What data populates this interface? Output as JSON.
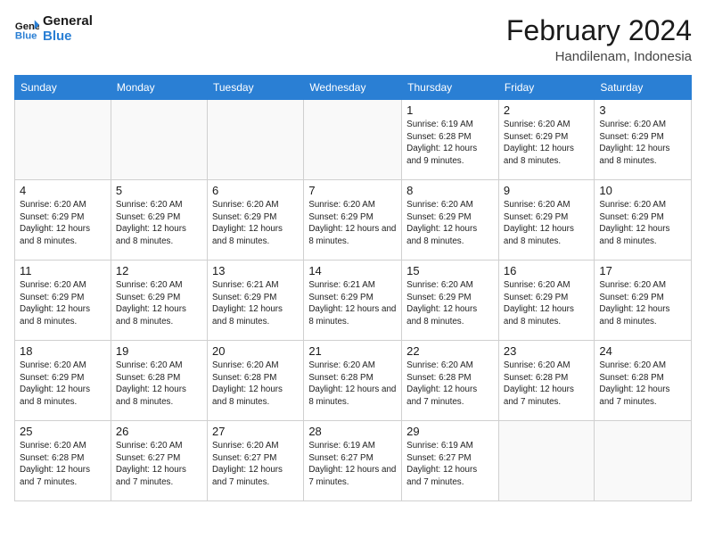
{
  "logo": {
    "line1": "General",
    "line2": "Blue"
  },
  "title": "February 2024",
  "location": "Handilenam, Indonesia",
  "days_of_week": [
    "Sunday",
    "Monday",
    "Tuesday",
    "Wednesday",
    "Thursday",
    "Friday",
    "Saturday"
  ],
  "weeks": [
    [
      {
        "num": "",
        "info": ""
      },
      {
        "num": "",
        "info": ""
      },
      {
        "num": "",
        "info": ""
      },
      {
        "num": "",
        "info": ""
      },
      {
        "num": "1",
        "info": "Sunrise: 6:19 AM\nSunset: 6:28 PM\nDaylight: 12 hours and 9 minutes."
      },
      {
        "num": "2",
        "info": "Sunrise: 6:20 AM\nSunset: 6:29 PM\nDaylight: 12 hours and 8 minutes."
      },
      {
        "num": "3",
        "info": "Sunrise: 6:20 AM\nSunset: 6:29 PM\nDaylight: 12 hours and 8 minutes."
      }
    ],
    [
      {
        "num": "4",
        "info": "Sunrise: 6:20 AM\nSunset: 6:29 PM\nDaylight: 12 hours and 8 minutes."
      },
      {
        "num": "5",
        "info": "Sunrise: 6:20 AM\nSunset: 6:29 PM\nDaylight: 12 hours and 8 minutes."
      },
      {
        "num": "6",
        "info": "Sunrise: 6:20 AM\nSunset: 6:29 PM\nDaylight: 12 hours and 8 minutes."
      },
      {
        "num": "7",
        "info": "Sunrise: 6:20 AM\nSunset: 6:29 PM\nDaylight: 12 hours and 8 minutes."
      },
      {
        "num": "8",
        "info": "Sunrise: 6:20 AM\nSunset: 6:29 PM\nDaylight: 12 hours and 8 minutes."
      },
      {
        "num": "9",
        "info": "Sunrise: 6:20 AM\nSunset: 6:29 PM\nDaylight: 12 hours and 8 minutes."
      },
      {
        "num": "10",
        "info": "Sunrise: 6:20 AM\nSunset: 6:29 PM\nDaylight: 12 hours and 8 minutes."
      }
    ],
    [
      {
        "num": "11",
        "info": "Sunrise: 6:20 AM\nSunset: 6:29 PM\nDaylight: 12 hours and 8 minutes."
      },
      {
        "num": "12",
        "info": "Sunrise: 6:20 AM\nSunset: 6:29 PM\nDaylight: 12 hours and 8 minutes."
      },
      {
        "num": "13",
        "info": "Sunrise: 6:21 AM\nSunset: 6:29 PM\nDaylight: 12 hours and 8 minutes."
      },
      {
        "num": "14",
        "info": "Sunrise: 6:21 AM\nSunset: 6:29 PM\nDaylight: 12 hours and 8 minutes."
      },
      {
        "num": "15",
        "info": "Sunrise: 6:20 AM\nSunset: 6:29 PM\nDaylight: 12 hours and 8 minutes."
      },
      {
        "num": "16",
        "info": "Sunrise: 6:20 AM\nSunset: 6:29 PM\nDaylight: 12 hours and 8 minutes."
      },
      {
        "num": "17",
        "info": "Sunrise: 6:20 AM\nSunset: 6:29 PM\nDaylight: 12 hours and 8 minutes."
      }
    ],
    [
      {
        "num": "18",
        "info": "Sunrise: 6:20 AM\nSunset: 6:29 PM\nDaylight: 12 hours and 8 minutes."
      },
      {
        "num": "19",
        "info": "Sunrise: 6:20 AM\nSunset: 6:28 PM\nDaylight: 12 hours and 8 minutes."
      },
      {
        "num": "20",
        "info": "Sunrise: 6:20 AM\nSunset: 6:28 PM\nDaylight: 12 hours and 8 minutes."
      },
      {
        "num": "21",
        "info": "Sunrise: 6:20 AM\nSunset: 6:28 PM\nDaylight: 12 hours and 8 minutes."
      },
      {
        "num": "22",
        "info": "Sunrise: 6:20 AM\nSunset: 6:28 PM\nDaylight: 12 hours and 7 minutes."
      },
      {
        "num": "23",
        "info": "Sunrise: 6:20 AM\nSunset: 6:28 PM\nDaylight: 12 hours and 7 minutes."
      },
      {
        "num": "24",
        "info": "Sunrise: 6:20 AM\nSunset: 6:28 PM\nDaylight: 12 hours and 7 minutes."
      }
    ],
    [
      {
        "num": "25",
        "info": "Sunrise: 6:20 AM\nSunset: 6:28 PM\nDaylight: 12 hours and 7 minutes."
      },
      {
        "num": "26",
        "info": "Sunrise: 6:20 AM\nSunset: 6:27 PM\nDaylight: 12 hours and 7 minutes."
      },
      {
        "num": "27",
        "info": "Sunrise: 6:20 AM\nSunset: 6:27 PM\nDaylight: 12 hours and 7 minutes."
      },
      {
        "num": "28",
        "info": "Sunrise: 6:19 AM\nSunset: 6:27 PM\nDaylight: 12 hours and 7 minutes."
      },
      {
        "num": "29",
        "info": "Sunrise: 6:19 AM\nSunset: 6:27 PM\nDaylight: 12 hours and 7 minutes."
      },
      {
        "num": "",
        "info": ""
      },
      {
        "num": "",
        "info": ""
      }
    ]
  ]
}
